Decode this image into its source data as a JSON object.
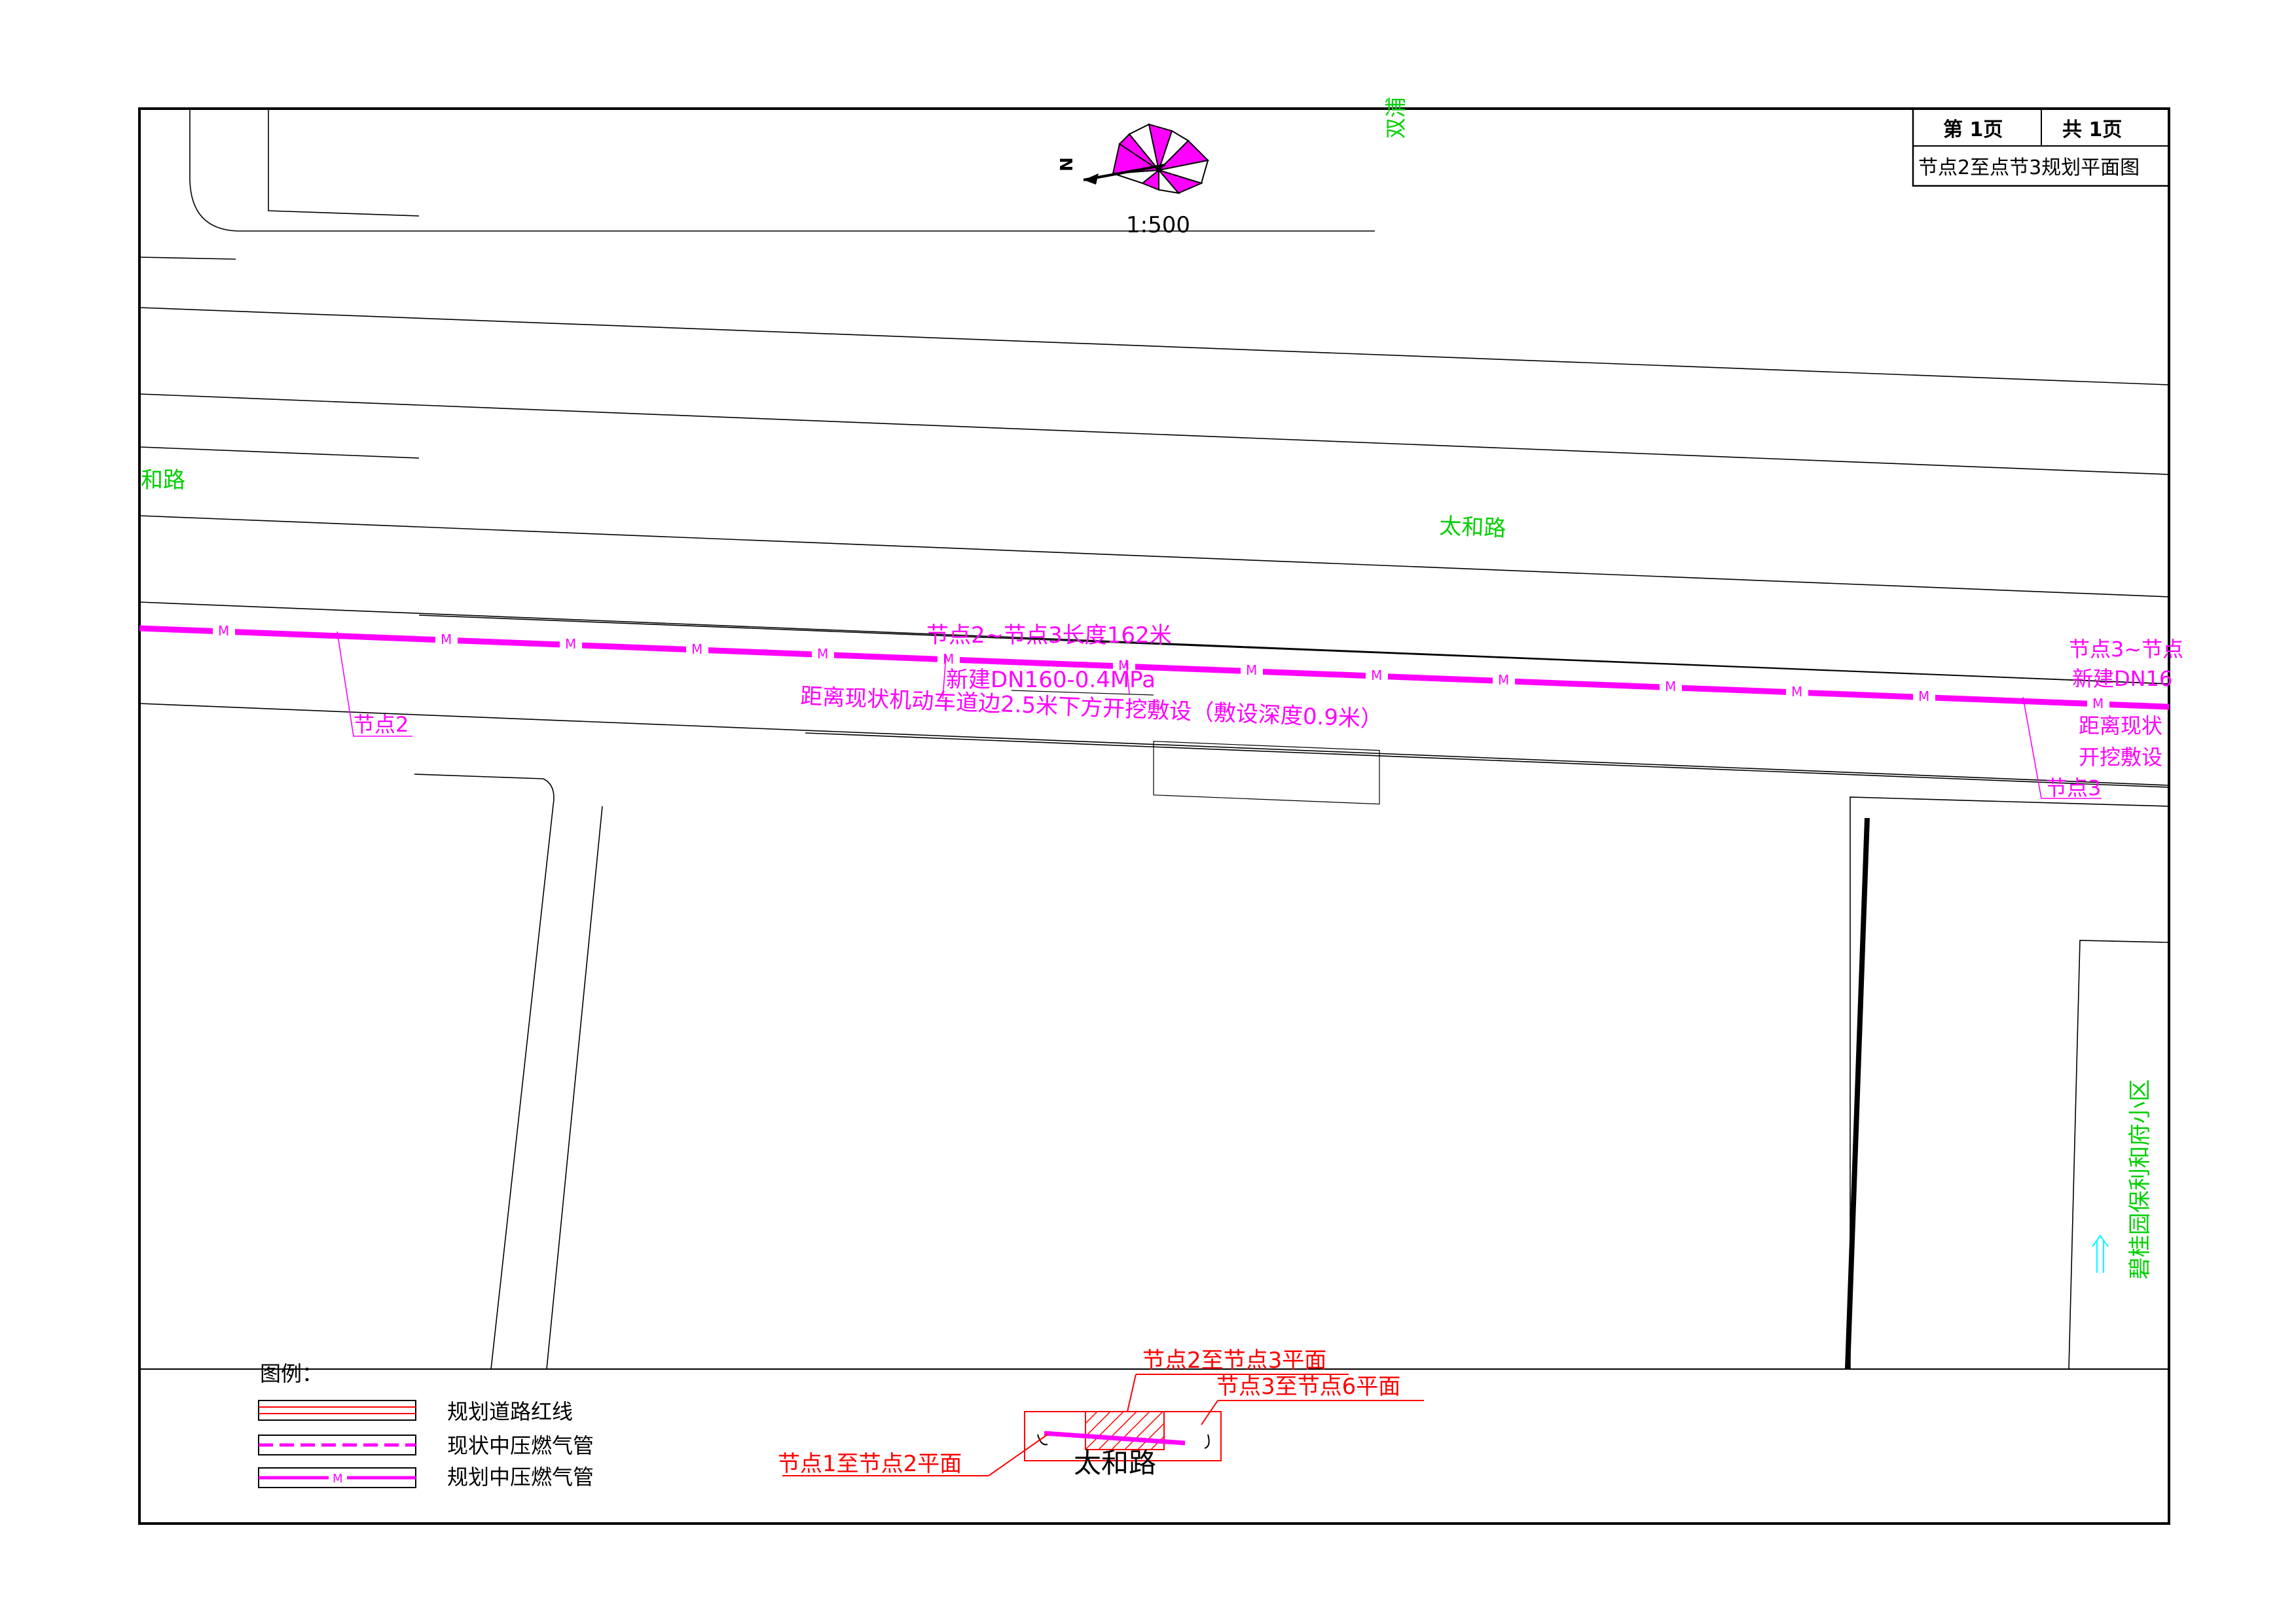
{
  "title_block": {
    "page_no": "第 1页",
    "page_total": "共 1页",
    "drawing_title": "节点2至点节3规划平面图"
  },
  "scale": "1:500",
  "north_label": "N",
  "road_labels": {
    "main_road": "太和路",
    "left_road": "和路",
    "top_road_partial": "双浦",
    "community": "碧桂园保利和府小区"
  },
  "pipeline": {
    "length_note": "节点2~节点3长度162米",
    "spec_note": "新建DN160-0.4MPa",
    "laying_note": "距离现状机动车道边2.5米下方开挖敷设（敷设深度0.9米）",
    "pipe_marker": "M",
    "node2_label": "节点2",
    "node3_label": "节点3",
    "right_partial_1": "节点3~节点",
    "right_partial_2": "新建DN16",
    "right_partial_3": "距离现状",
    "right_partial_4": "开挖敷设"
  },
  "legend": {
    "title": "图例：",
    "items": [
      {
        "label": "规划道路红线",
        "type": "red-double-line"
      },
      {
        "label": "现状中压燃气管",
        "type": "magenta-dashed"
      },
      {
        "label": "规划中压燃气管",
        "type": "magenta-M"
      }
    ]
  },
  "key_map": {
    "label_center": "节点2至节点3平面",
    "label_right": "节点3至节点6平面",
    "label_left": "节点1至节点2平面",
    "road_name": "太和路"
  },
  "colors": {
    "pipe": "#ff00ff",
    "road_label": "#00d000",
    "key_map": "#ff0000",
    "line": "#000000"
  }
}
